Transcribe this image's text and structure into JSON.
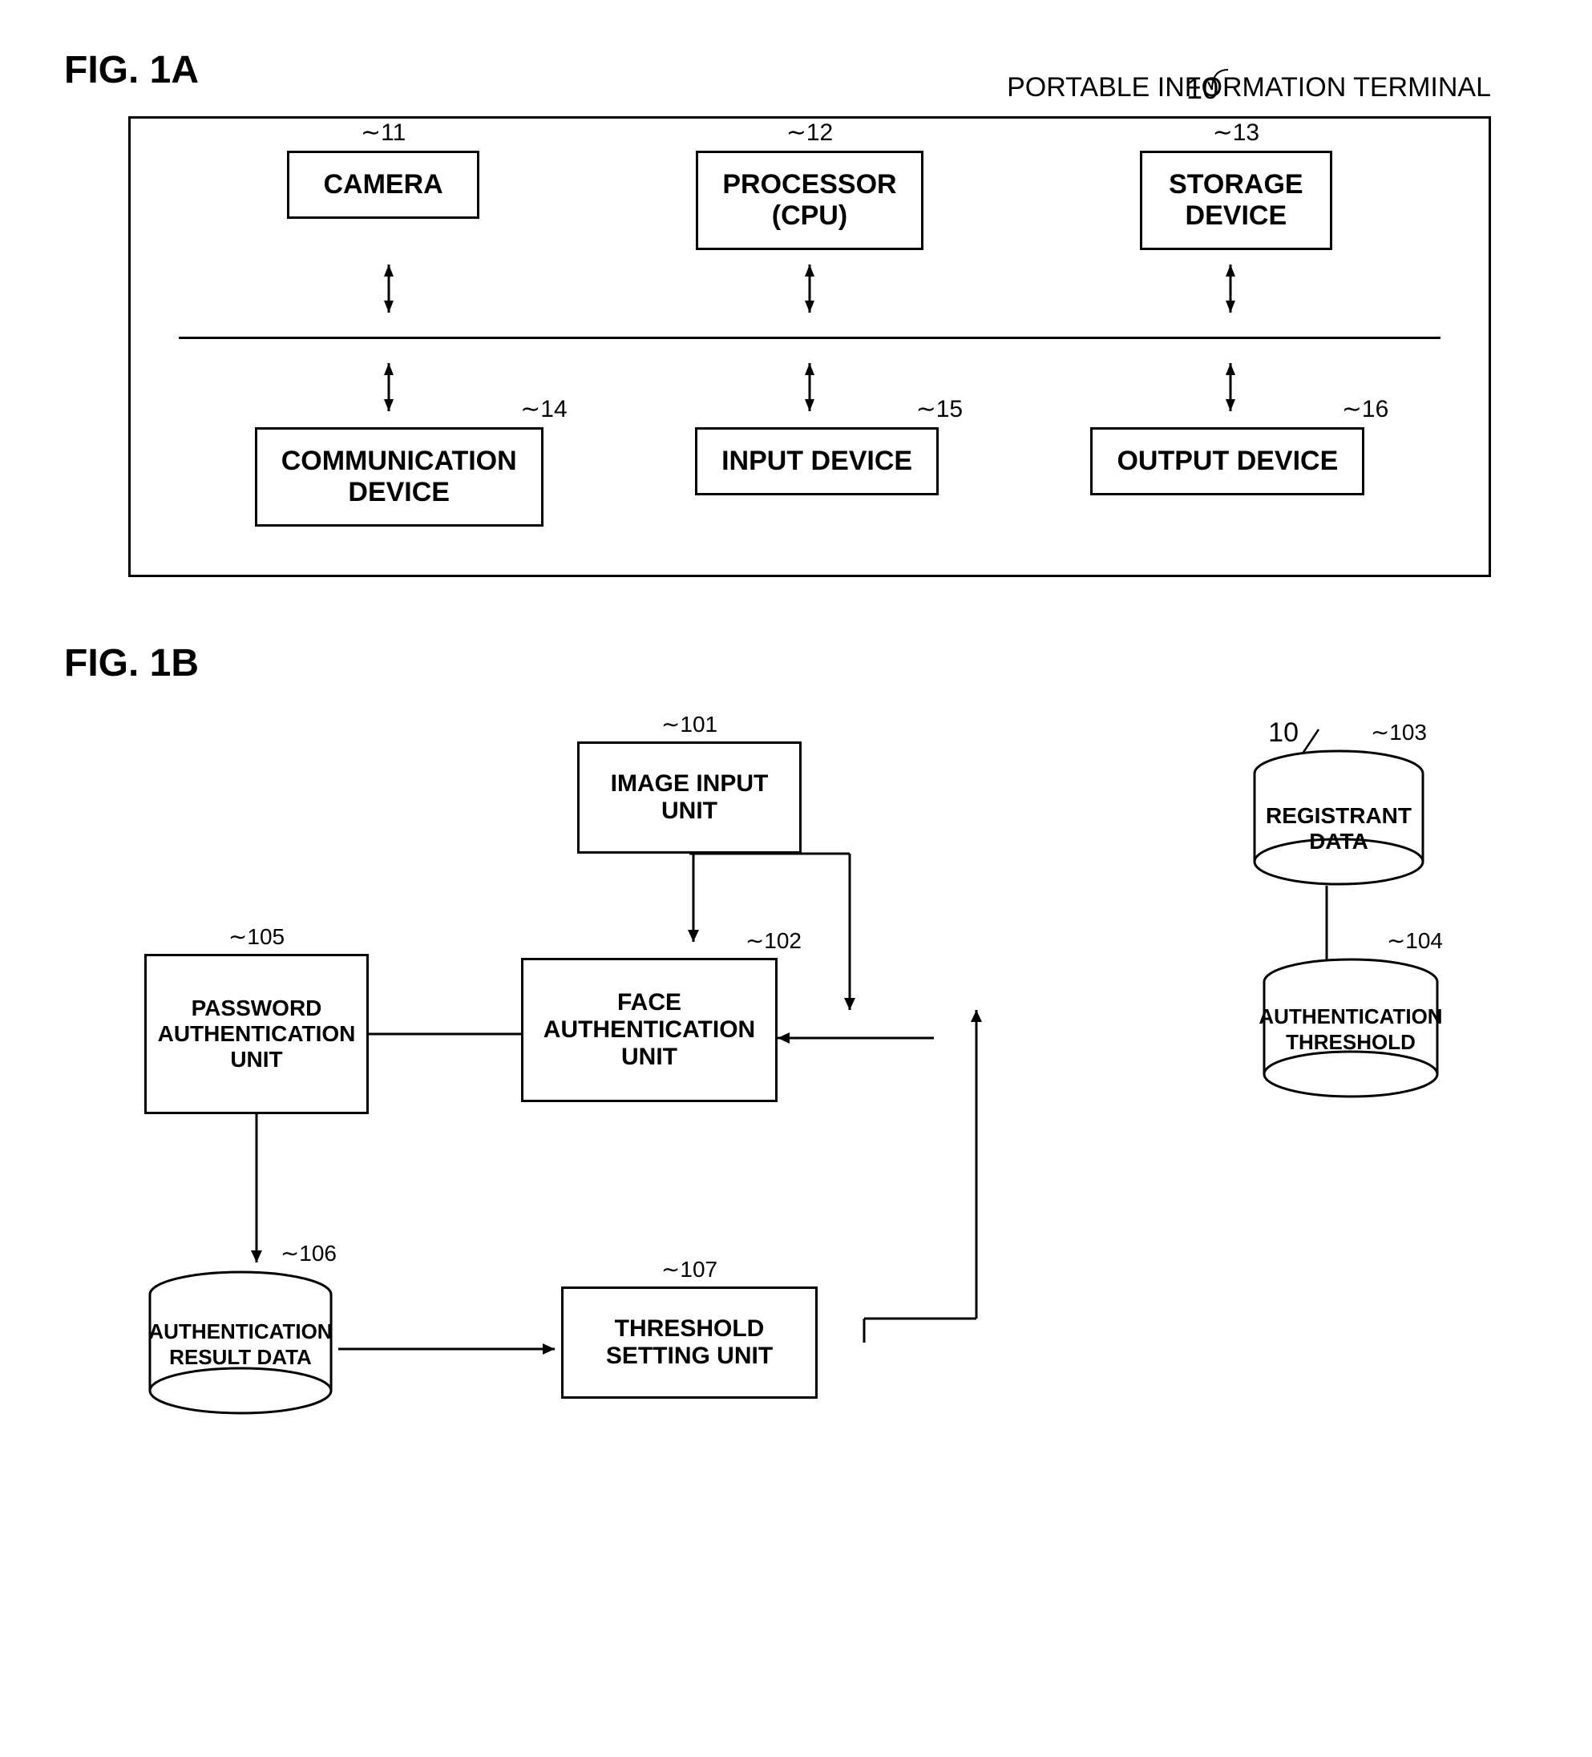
{
  "fig1a": {
    "label": "FIG. 1A",
    "terminal_ref": "10",
    "terminal_name": "PORTABLE INFORMATION TERMINAL",
    "components": [
      {
        "ref": "11",
        "label": "CAMERA"
      },
      {
        "ref": "12",
        "label": "PROCESSOR\n(CPU)"
      },
      {
        "ref": "13",
        "label": "STORAGE\nDEVICE"
      },
      {
        "ref": "14",
        "label": "COMMUNICATION\nDEVICE"
      },
      {
        "ref": "15",
        "label": "INPUT DEVICE"
      },
      {
        "ref": "16",
        "label": "OUTPUT DEVICE"
      }
    ]
  },
  "fig1b": {
    "label": "FIG. 1B",
    "terminal_ref": "10",
    "components": [
      {
        "id": "101",
        "ref": "101",
        "label": "IMAGE INPUT\nUNIT"
      },
      {
        "id": "102",
        "ref": "102",
        "label": "FACE\nAUTHENTICATION\nUNIT"
      },
      {
        "id": "103",
        "ref": "103",
        "label": "REGISTRANT\nDATA"
      },
      {
        "id": "104",
        "ref": "104",
        "label": "AUTHENTICATION\nTHRESHOLD"
      },
      {
        "id": "105",
        "ref": "105",
        "label": "PASSWORD\nAUTHENTICATION\nUNIT"
      },
      {
        "id": "106",
        "ref": "106",
        "label": "AUTHENTICATION\nRESULT DATA"
      },
      {
        "id": "107",
        "ref": "107",
        "label": "THRESHOLD\nSETTING UNIT"
      }
    ]
  }
}
